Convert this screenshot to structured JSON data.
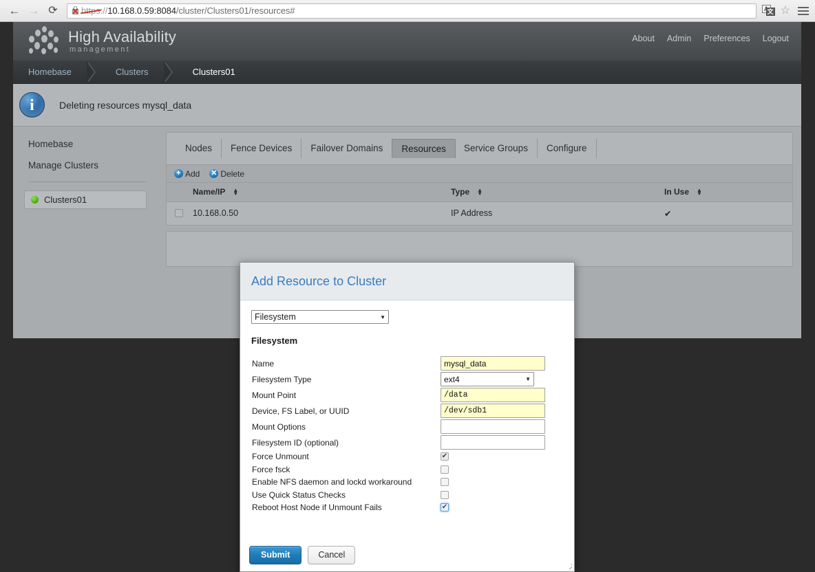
{
  "browser": {
    "back_icon": "arrow-left-icon",
    "forward_icon": "arrow-right-icon",
    "reload_icon": "reload-icon",
    "cert_icon": "broken-certificate-icon",
    "url_scheme": "https",
    "url_separator": "://",
    "url_host": "10.168.0.59:8084",
    "url_path": "/cluster/Clusters01/resources#",
    "translate_icon": "translate-icon",
    "bookmark_icon": "star-icon",
    "menu_icon": "hamburger-menu-icon"
  },
  "app": {
    "brand_title": "High Availability",
    "brand_subtitle": "management",
    "top_nav": [
      "About",
      "Admin",
      "Preferences",
      "Logout"
    ],
    "breadcrumb": [
      "Homebase",
      "Clusters",
      "Clusters01"
    ],
    "banner": {
      "icon": "info-icon",
      "text": "Deleting resources mysql_data"
    },
    "sidebar": {
      "links": [
        "Homebase",
        "Manage Clusters"
      ],
      "cluster": {
        "name": "Clusters01",
        "status_color": "#5fbf1f"
      }
    },
    "tabs": [
      {
        "label": "Nodes",
        "active": false
      },
      {
        "label": "Fence Devices",
        "active": false
      },
      {
        "label": "Failover Domains",
        "active": false
      },
      {
        "label": "Resources",
        "active": true
      },
      {
        "label": "Service Groups",
        "active": false
      },
      {
        "label": "Configure",
        "active": false
      }
    ],
    "toolbar": {
      "add_label": "Add",
      "add_icon": "plus-circle-icon",
      "delete_label": "Delete",
      "delete_icon": "x-circle-icon"
    },
    "table": {
      "columns": [
        "Name/IP",
        "Type",
        "In Use"
      ],
      "rows": [
        {
          "name": "10.168.0.50",
          "type": "IP Address",
          "in_use": "✔"
        }
      ]
    }
  },
  "modal": {
    "title": "Add Resource to Cluster",
    "resource_type": "Filesystem",
    "section_title": "Filesystem",
    "fields": [
      {
        "label": "Name",
        "value": "mysql_data",
        "kind": "text",
        "filled": true
      },
      {
        "label": "Filesystem Type",
        "value": "ext4",
        "kind": "select",
        "filled": false
      },
      {
        "label": "Mount Point",
        "value": "/data",
        "kind": "text",
        "filled": true
      },
      {
        "label": "Device, FS Label, or UUID",
        "value": "/dev/sdb1",
        "kind": "text",
        "filled": true
      },
      {
        "label": "Mount Options",
        "value": "",
        "kind": "text",
        "filled": false
      },
      {
        "label": "Filesystem ID (optional)",
        "value": "",
        "kind": "text",
        "filled": false
      }
    ],
    "checkboxes": [
      {
        "label": "Force Unmount",
        "checked": true,
        "focused": false
      },
      {
        "label": "Force fsck",
        "checked": false,
        "focused": false
      },
      {
        "label": "Enable NFS daemon and lockd workaround",
        "checked": false,
        "focused": false
      },
      {
        "label": "Use Quick Status Checks",
        "checked": false,
        "focused": false
      },
      {
        "label": "Reboot Host Node if Unmount Fails",
        "checked": true,
        "focused": true
      }
    ],
    "submit_label": "Submit",
    "cancel_label": "Cancel",
    "resize_handle": "resize-grip-icon",
    "accent_color": "#3a7bbf"
  }
}
